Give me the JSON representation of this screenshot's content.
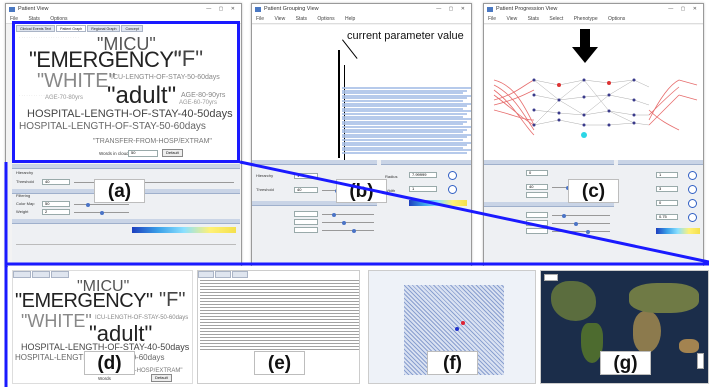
{
  "colors": {
    "accent_blue": "#1a1aff",
    "arrow": "#000000",
    "map_ocean": "#1b2d4a"
  },
  "windowA": {
    "title": "Patient View",
    "menu": [
      "File",
      "Stats",
      "Options"
    ],
    "tabs": [
      "Clinical Events Text",
      "Patient Graph",
      "Regional Graph",
      "Concept"
    ],
    "cloud": {
      "micu": "\"MICU\"",
      "emergency": "\"EMERGENCY\"",
      "f": "\"F\"",
      "white": "\"WHITE\"",
      "adult": "\"adult\"",
      "icu60": "ICU-LENGTH-OF-STAY-50-60days",
      "age8090": "AGE-80-90yrs",
      "age7080": "AGE-70-80yrs",
      "age6070": "AGE-60-70yrs",
      "hosp4050": "HOSPITAL-LENGTH-OF-STAY-40-50days",
      "hosp5060": "HOSPITAL-LENGTH-OF-STAY-50-60days",
      "transfer": "\"TRANSFER-FROM-HOSP/EXTRAM\"",
      "word_limit_label": "Words in cloud",
      "word_limit_value": "50",
      "default_button": "Default"
    },
    "controls": {
      "section1": "Hierarchy",
      "threshold_label": "Threshold",
      "threshold_value": "40",
      "section2": "Filtering",
      "row_a_label": "Color Map",
      "row_a_value": "50",
      "row_b_label": "Weight",
      "row_b_value": "2"
    },
    "label": "(a)"
  },
  "windowB": {
    "title": "Patient Grouping View",
    "menu": [
      "File",
      "View",
      "Stats",
      "Options",
      "Help"
    ],
    "annotation": "current parameter value",
    "field1_label": "Hierarchy",
    "field1_value": "1",
    "field2_label": "Threshold",
    "field2_value": "40",
    "right_label1": "Radius",
    "right_value1": "7.99999",
    "right_label2": "Width",
    "right_value2": "1",
    "label": "(b)"
  },
  "windowC": {
    "title": "Patient Progression View",
    "menu": [
      "File",
      "View",
      "Stats",
      "Select",
      "Phenotype",
      "Options"
    ],
    "field1_value": "0",
    "field2_value": "40",
    "r1": "1",
    "r2": "3",
    "r3": "0",
    "r4": "0.75",
    "label": "(c)"
  },
  "bottom": {
    "d_cloud": {
      "micu": "\"MICU\"",
      "emergency": "\"EMERGENCY\"",
      "f": "\"F\"",
      "white": "\"WHITE\"",
      "adult": "\"adult\"",
      "icu": "ICU-LENGTH-OF-STAY-50-60days",
      "hosp4050": "HOSPITAL-LENGTH-OF-STAY-40-50days",
      "hosp5060": "HOSPITAL-LENGTH-OF-STAY-50-60days",
      "transfer": "OM-HOSP/EXTRAM\"",
      "words": "Words",
      "default_button": "Default"
    },
    "labels": [
      "(d)",
      "(e)",
      "(f)",
      "(g)"
    ]
  }
}
